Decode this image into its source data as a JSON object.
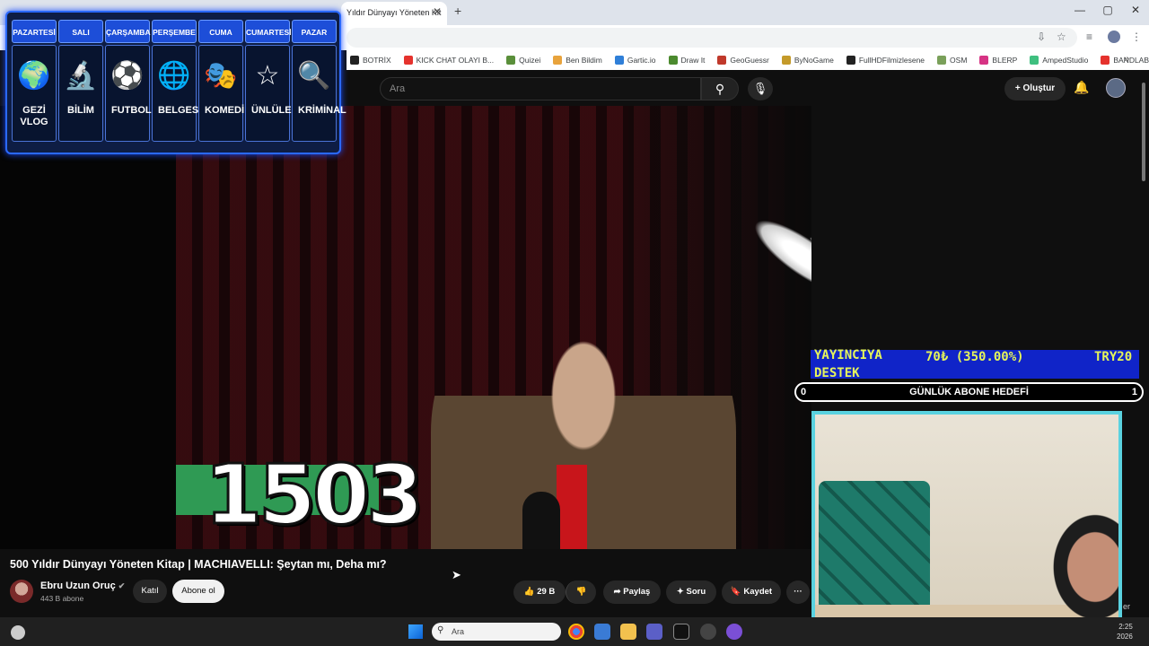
{
  "browser": {
    "tab_title": "Yıldır Dünyayı Yöneten Kit",
    "tab_close": "✕",
    "new_tab": "+",
    "window_controls": [
      "—",
      "▢",
      "✕"
    ],
    "bookmarks": [
      {
        "label": "BOTRİX",
        "color": "#222222"
      },
      {
        "label": "KICK CHAT OLAYI B...",
        "color": "#e5322d"
      },
      {
        "label": "Quizei",
        "color": "#5a8f3a"
      },
      {
        "label": "Ben Bildim",
        "color": "#e8a33c"
      },
      {
        "label": "Gartic.io",
        "color": "#2f7fd8"
      },
      {
        "label": "Draw It",
        "color": "#4b8a2e"
      },
      {
        "label": "GeoGuessr",
        "color": "#c0392b"
      },
      {
        "label": "ByNoGame",
        "color": "#c49a2a"
      },
      {
        "label": "FullHDFilmizlesene",
        "color": "#222222"
      },
      {
        "label": "OSM",
        "color": "#7aa05a"
      },
      {
        "label": "BLERP",
        "color": "#d63384"
      },
      {
        "label": "AmpedStudio",
        "color": "#3fbf7f"
      },
      {
        "label": "BANDLAB",
        "color": "#e5322d"
      }
    ],
    "more_bookmarks": "»"
  },
  "youtube": {
    "search_placeholder": "Ara",
    "create_label": "Oluştur",
    "video_title": "500 Yıldır Dünyayı Yöneten Kitap | MACHIAVELLI: Şeytan mı, Deha mı?",
    "channel_name": "Ebru Uzun Oruç",
    "channel_subs": "443 B abone",
    "join_label": "Katıl",
    "subscribe_label": "Abone ol",
    "like_count": "29 B",
    "share_label": "Paylaş",
    "ask_label": "Soru",
    "save_label": "Kaydet",
    "more_label": "···",
    "counter_overlay": "1503"
  },
  "schedule": {
    "days": [
      {
        "day": "PAZARTESİ",
        "label": "GEZİ VLOG",
        "icon": "globe-plane-icon",
        "glyph": "🌍"
      },
      {
        "day": "SALI",
        "label": "BİLİM",
        "icon": "microscope-icon",
        "glyph": "🔬"
      },
      {
        "day": "ÇARŞAMBA",
        "label": "FUTBOL",
        "icon": "soccer-ball-icon",
        "glyph": "⚽"
      },
      {
        "day": "PERŞEMBE",
        "label": "BELGESEL",
        "icon": "earth-icon",
        "glyph": "🌐"
      },
      {
        "day": "CUMA",
        "label": "KOMEDİ",
        "icon": "comedy-mask-icon",
        "glyph": "🎭"
      },
      {
        "day": "CUMARTESİ",
        "label": "ÜNLÜLER",
        "icon": "star-icon",
        "glyph": "☆"
      },
      {
        "day": "PAZAR",
        "label": "KRİMİNAL",
        "icon": "fingerprint-magnifier-icon",
        "glyph": "🔍"
      }
    ]
  },
  "stream": {
    "donate_line1": "YAYINCIYA",
    "donate_line2": "DESTEK",
    "donate_amount": "70₺ (350.00%)",
    "donate_goal": "TRY20",
    "goal_label": "GÜNLÜK ABONE HEDEFİ",
    "goal_current": "0",
    "goal_target": "1",
    "webcam_partial": "er"
  },
  "taskbar": {
    "search_placeholder": "Ara",
    "clock_time": "2:25",
    "clock_date": "2026"
  },
  "colors": {
    "schedule_border": "#2a69ff",
    "donate_bg": "#1024c8",
    "donate_text": "#e6f55a",
    "webcam_border": "#5ad2e0"
  }
}
